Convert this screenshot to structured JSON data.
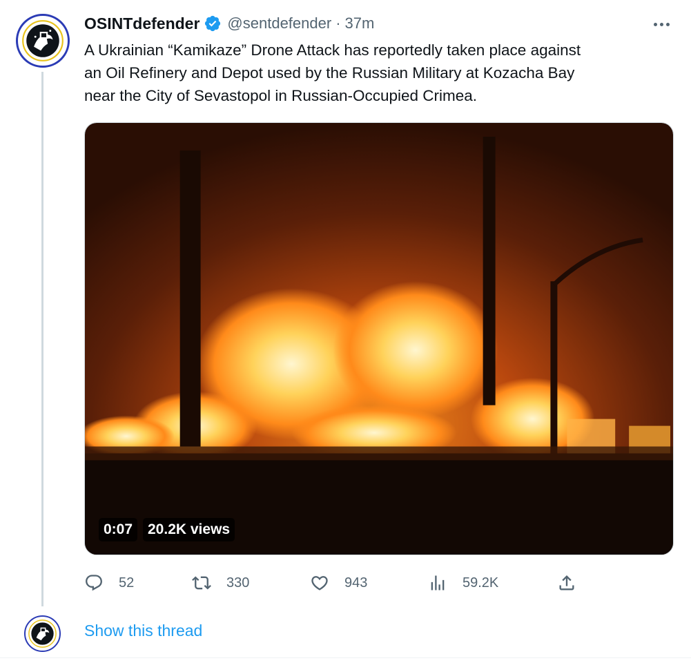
{
  "tweet": {
    "display_name": "OSINTdefender",
    "handle": "@sentdefender",
    "separator": "·",
    "time": "37m",
    "verified_icon": "verified-badge-icon",
    "text_lines": [
      "A Ukrainian “Kamikaze” Drone Attack has reportedly taken place against",
      "an Oil Refinery and Depot used by the Russian Military at Kozacha Bay",
      "near the City of Sevastopol in Russian-Occupied Crimea."
    ],
    "video": {
      "duration": "0:07",
      "views": "20.2K views"
    },
    "actions": {
      "replies": "52",
      "retweets": "330",
      "likes": "943",
      "views": "59.2K"
    }
  },
  "thread": {
    "show_thread_label": "Show this thread"
  },
  "colors": {
    "accent": "#1d9bf0",
    "text_primary": "#0f1419",
    "text_secondary": "#536471",
    "avatar_ring": "#2b3bb5"
  }
}
